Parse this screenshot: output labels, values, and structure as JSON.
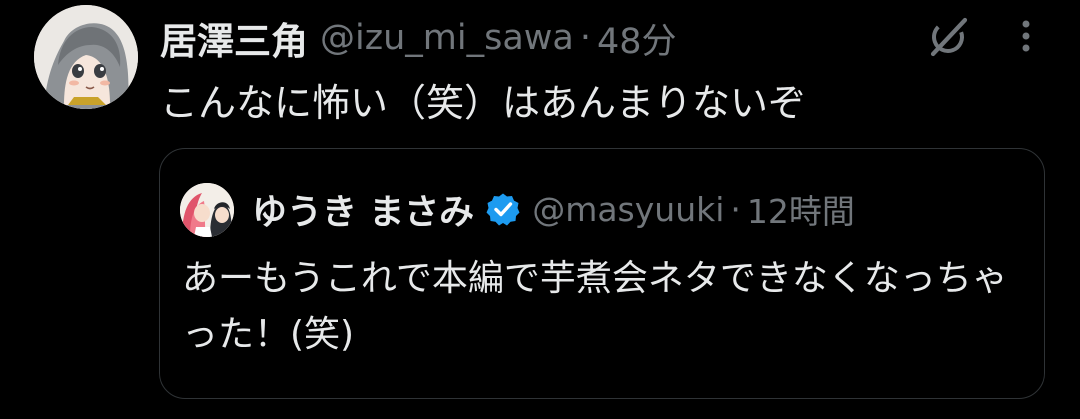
{
  "tweet": {
    "display_name": "居澤三角",
    "handle": "@izu_mi_sawa",
    "separator": "·",
    "time": "48分",
    "text": "こんなに怖い（笑）はあんまりないぞ",
    "avatar_icon": "user-avatar-anime-girl",
    "grok_icon": "grok-icon",
    "more_icon": "more-vertical-icon"
  },
  "quote": {
    "display_name": "ゆうき まさみ",
    "handle": "@masyuuki",
    "separator": "·",
    "time": "12時間",
    "text": "あーもうこれで本編で芋煮会ネタできなくなっちゃった！(笑)",
    "verified_icon": "verified-badge-icon",
    "verified_color": "#1d9bf0"
  },
  "colors": {
    "background": "#000000",
    "text_primary": "#e7e9ea",
    "text_secondary": "#71767b",
    "card_border": "#2f3336"
  }
}
